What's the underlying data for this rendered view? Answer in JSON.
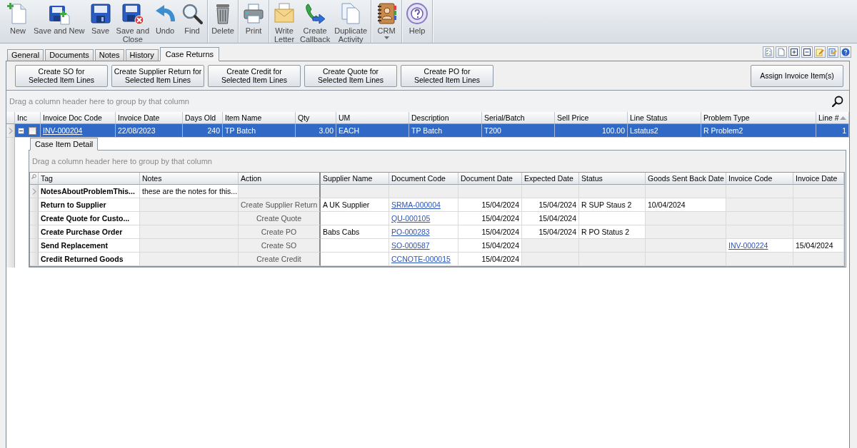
{
  "toolbar": {
    "groups": [
      [
        {
          "label": "New",
          "dropdown": false
        },
        {
          "label": "Save and New",
          "dropdown": false
        },
        {
          "label": "Save",
          "dropdown": false
        },
        {
          "label": "Save and\nClose",
          "dropdown": false
        },
        {
          "label": "Undo",
          "dropdown": false
        },
        {
          "label": "Find",
          "dropdown": false
        }
      ],
      [
        {
          "label": "Delete",
          "dropdown": false
        }
      ],
      [
        {
          "label": "Print",
          "dropdown": false
        }
      ],
      [
        {
          "label": "Write\nLetter",
          "dropdown": false
        },
        {
          "label": "Create\nCallback",
          "dropdown": false
        },
        {
          "label": "Duplicate\nActivity",
          "dropdown": false
        }
      ],
      [
        {
          "label": "CRM",
          "dropdown": true
        }
      ],
      [
        {
          "label": "Help",
          "dropdown": false
        }
      ]
    ]
  },
  "tabs": [
    {
      "label": "General",
      "selected": false
    },
    {
      "label": "Documents",
      "selected": false
    },
    {
      "label": "Notes",
      "selected": false
    },
    {
      "label": "History",
      "selected": false
    },
    {
      "label": "Case Returns",
      "selected": true
    }
  ],
  "action_buttons": [
    "Create SO for\nSelected Item Lines",
    "Create Supplier Return for\nSelected Item Lines",
    "Create Credit for\nSelected Item Lines",
    "Create Quote for\nSelected Item Lines",
    "Create PO for\nSelected Item Lines"
  ],
  "assign_button": "Assign Invoice Item(s)",
  "main_grid": {
    "group_hint": "Drag a column header here to group by that column",
    "columns": [
      {
        "label": "Inc",
        "kind": "check",
        "sorted": false
      },
      {
        "label": "Invoice Doc Code",
        "kind": "link",
        "sorted": false
      },
      {
        "label": "Invoice Date",
        "kind": "text",
        "sorted": false
      },
      {
        "label": "Days Old",
        "kind": "number",
        "sorted": false
      },
      {
        "label": "Item Name",
        "kind": "text",
        "sorted": false
      },
      {
        "label": "Qty",
        "kind": "number",
        "sorted": false
      },
      {
        "label": "UM",
        "kind": "text",
        "sorted": false
      },
      {
        "label": "Description",
        "kind": "text",
        "sorted": false
      },
      {
        "label": "Serial/Batch",
        "kind": "text",
        "sorted": false
      },
      {
        "label": "Sell Price",
        "kind": "number",
        "sorted": false
      },
      {
        "label": "Line Status",
        "kind": "text",
        "sorted": false
      },
      {
        "label": "Problem Type",
        "kind": "text",
        "sorted": false
      },
      {
        "label": "Line #",
        "kind": "number",
        "sorted": true
      }
    ],
    "rows": [
      {
        "selected": true,
        "current": true,
        "expanded": true,
        "cells": [
          {
            "checked": false
          },
          {
            "text": "INV-000204"
          },
          {
            "text": "22/08/2023"
          },
          {
            "text": "240"
          },
          {
            "text": "TP Batch"
          },
          {
            "text": "3.00"
          },
          {
            "text": "EACH"
          },
          {
            "text": "TP Batch"
          },
          {
            "text": "T200"
          },
          {
            "text": "100.00"
          },
          {
            "text": "Lstatus2"
          },
          {
            "text": "R Problem2"
          },
          {
            "text": "1"
          }
        ],
        "detail": {
          "tabs": [
            {
              "label": "Case Item Detail",
              "selected": true
            }
          ],
          "group_hint": "Drag a column header here to group by that column",
          "columns": [
            {
              "label": "Tag",
              "kind": "tag"
            },
            {
              "label": "Notes",
              "kind": "text"
            },
            {
              "label": "Action",
              "kind": "action"
            },
            {
              "label": "Supplier Name",
              "kind": "text"
            },
            {
              "label": "Document Code",
              "kind": "link"
            },
            {
              "label": "Document Date",
              "kind": "date"
            },
            {
              "label": "Expected Date",
              "kind": "date"
            },
            {
              "label": "Status",
              "kind": "text"
            },
            {
              "label": "Goods Sent Back Date",
              "kind": "text"
            },
            {
              "label": "Invoice Code",
              "kind": "link"
            },
            {
              "label": "Invoice Date",
              "kind": "text"
            }
          ],
          "rows": [
            {
              "current": true,
              "cells": [
                {
                  "text": "NotesAboutProblemThis...",
                  "disabled": false
                },
                {
                  "text": "these are the notes for this...",
                  "disabled": false
                },
                {
                  "disabled": true
                },
                {
                  "disabled": true
                },
                {
                  "disabled": true
                },
                {
                  "disabled": true
                },
                {
                  "disabled": true
                },
                {
                  "disabled": true
                },
                {
                  "disabled": true
                },
                {
                  "disabled": true
                },
                {
                  "disabled": true
                }
              ]
            },
            {
              "current": false,
              "cells": [
                {
                  "text": "Return to Supplier",
                  "disabled": false
                },
                {
                  "disabled": true
                },
                {
                  "text": "Create Supplier Return",
                  "disabled": true
                },
                {
                  "text": "A UK Supplier",
                  "disabled": false
                },
                {
                  "text": "SRMA-000004",
                  "disabled": false
                },
                {
                  "text": "15/04/2024",
                  "disabled": false
                },
                {
                  "text": "15/04/2024",
                  "disabled": false
                },
                {
                  "text": "R SUP Staus 2",
                  "disabled": false
                },
                {
                  "text": "10/04/2024",
                  "disabled": false
                },
                {
                  "disabled": true
                },
                {
                  "disabled": true
                }
              ]
            },
            {
              "current": false,
              "cells": [
                {
                  "text": "Create Quote for Custo...",
                  "disabled": false
                },
                {
                  "disabled": true
                },
                {
                  "text": "Create Quote",
                  "disabled": true
                },
                {
                  "disabled": false
                },
                {
                  "text": "QU-000105",
                  "disabled": false
                },
                {
                  "text": "15/04/2024",
                  "disabled": false
                },
                {
                  "text": "15/04/2024",
                  "disabled": false
                },
                {
                  "disabled": false
                },
                {
                  "disabled": true
                },
                {
                  "disabled": true
                },
                {
                  "disabled": true
                }
              ]
            },
            {
              "current": false,
              "cells": [
                {
                  "text": "Create Purchase Order",
                  "disabled": false
                },
                {
                  "disabled": true
                },
                {
                  "text": "Create PO",
                  "disabled": true
                },
                {
                  "text": "Babs Cabs",
                  "disabled": false
                },
                {
                  "text": "PO-000283",
                  "disabled": false
                },
                {
                  "text": "15/04/2024",
                  "disabled": false
                },
                {
                  "text": "15/04/2024",
                  "disabled": false
                },
                {
                  "text": "R PO Status 2",
                  "disabled": false
                },
                {
                  "disabled": true
                },
                {
                  "disabled": true
                },
                {
                  "disabled": true
                }
              ]
            },
            {
              "current": false,
              "cells": [
                {
                  "text": "Send Replacement",
                  "disabled": false
                },
                {
                  "disabled": true
                },
                {
                  "text": "Create SO",
                  "disabled": true
                },
                {
                  "disabled": false
                },
                {
                  "text": "SO-000587",
                  "disabled": false
                },
                {
                  "text": "15/04/2024",
                  "disabled": false
                },
                {
                  "disabled": true
                },
                {
                  "disabled": true
                },
                {
                  "disabled": true
                },
                {
                  "text": "INV-000224",
                  "disabled": false
                },
                {
                  "text": "15/04/2024",
                  "disabled": false
                }
              ]
            },
            {
              "current": false,
              "cells": [
                {
                  "text": "Credit Returned Goods",
                  "disabled": false
                },
                {
                  "disabled": true
                },
                {
                  "text": "Create Credit",
                  "disabled": true
                },
                {
                  "disabled": false
                },
                {
                  "text": "CCNOTE-000015",
                  "disabled": false
                },
                {
                  "text": "15/04/2024",
                  "disabled": false
                },
                {
                  "disabled": true
                },
                {
                  "disabled": true
                },
                {
                  "disabled": true
                },
                {
                  "disabled": true
                },
                {
                  "disabled": true
                }
              ]
            }
          ]
        }
      }
    ]
  }
}
